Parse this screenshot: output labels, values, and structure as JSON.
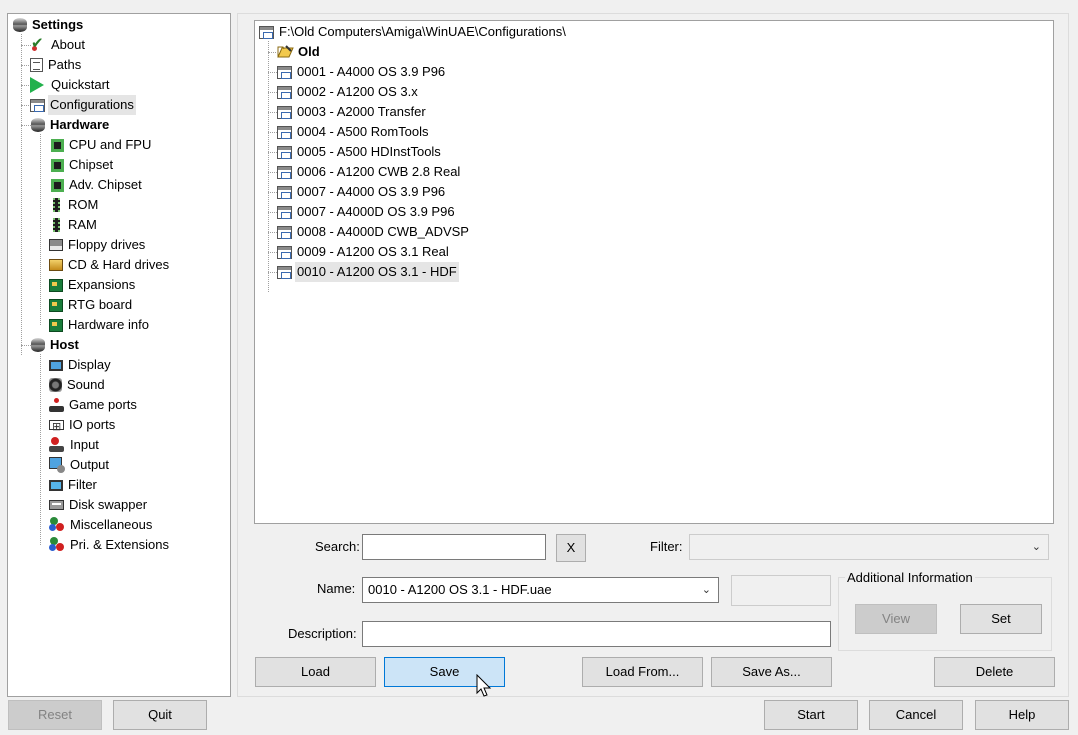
{
  "settings_tree": {
    "root": "Settings",
    "items": [
      {
        "label": "About",
        "icon": "about-icon"
      },
      {
        "label": "Paths",
        "icon": "paths-icon"
      },
      {
        "label": "Quickstart",
        "icon": "quickstart-icon"
      },
      {
        "label": "Configurations",
        "icon": "configurations-icon",
        "selected": true
      }
    ],
    "hardware": {
      "label": "Hardware",
      "items": [
        {
          "label": "CPU and FPU",
          "icon": "cpu-icon"
        },
        {
          "label": "Chipset",
          "icon": "chipset-icon"
        },
        {
          "label": "Adv. Chipset",
          "icon": "adv-chipset-icon"
        },
        {
          "label": "ROM",
          "icon": "rom-icon"
        },
        {
          "label": "RAM",
          "icon": "ram-icon"
        },
        {
          "label": "Floppy drives",
          "icon": "floppy-icon"
        },
        {
          "label": "CD & Hard drives",
          "icon": "hard-drive-icon"
        },
        {
          "label": "Expansions",
          "icon": "expansion-card-icon"
        },
        {
          "label": "RTG board",
          "icon": "rtg-card-icon"
        },
        {
          "label": "Hardware info",
          "icon": "hardware-info-icon"
        }
      ]
    },
    "host": {
      "label": "Host",
      "items": [
        {
          "label": "Display",
          "icon": "monitor-icon"
        },
        {
          "label": "Sound",
          "icon": "speaker-icon"
        },
        {
          "label": "Game ports",
          "icon": "joystick-icon"
        },
        {
          "label": "IO ports",
          "icon": "io-ports-icon"
        },
        {
          "label": "Input",
          "icon": "input-icon"
        },
        {
          "label": "Output",
          "icon": "output-icon"
        },
        {
          "label": "Filter",
          "icon": "filter-icon"
        },
        {
          "label": "Disk swapper",
          "icon": "disk-swapper-icon"
        },
        {
          "label": "Miscellaneous",
          "icon": "misc-icon"
        },
        {
          "label": "Pri. & Extensions",
          "icon": "extensions-icon"
        }
      ]
    }
  },
  "config_tree": {
    "path": "F:\\Old Computers\\Amiga\\WinUAE\\Configurations\\",
    "folder": "Old",
    "configs": [
      "0001 - A4000 OS 3.9 P96",
      "0002 - A1200 OS 3.x",
      "0003 - A2000 Transfer",
      "0004 - A500 RomTools",
      "0005 - A500 HDInstTools",
      "0006 - A1200 CWB 2.8 Real",
      "0007 - A4000 OS 3.9 P96",
      "0007 - A4000D OS 3.9 P96",
      "0008 - A4000D CWB_ADVSP",
      "0009 - A1200 OS 3.1 Real",
      "0010 - A1200 OS 3.1 - HDF"
    ],
    "selected_index": 10
  },
  "form": {
    "search_label": "Search:",
    "search_value": "",
    "clear_label": "X",
    "filter_label": "Filter:",
    "filter_value": "",
    "name_label": "Name:",
    "name_value": "0010 - A1200 OS 3.1 - HDF.uae",
    "description_label": "Description:",
    "description_value": "",
    "additional_info_label": "Additional Information",
    "view_label": "View",
    "set_label": "Set"
  },
  "actions": {
    "load": "Load",
    "save": "Save",
    "load_from": "Load From...",
    "save_as": "Save As...",
    "delete": "Delete"
  },
  "footer": {
    "reset": "Reset",
    "quit": "Quit",
    "start": "Start",
    "cancel": "Cancel",
    "help": "Help"
  },
  "colors": {
    "window_bg": "#f0f0f0",
    "selection": "#e5e5e5",
    "focus_button": "#cce4f7",
    "focus_border": "#0078d7"
  }
}
